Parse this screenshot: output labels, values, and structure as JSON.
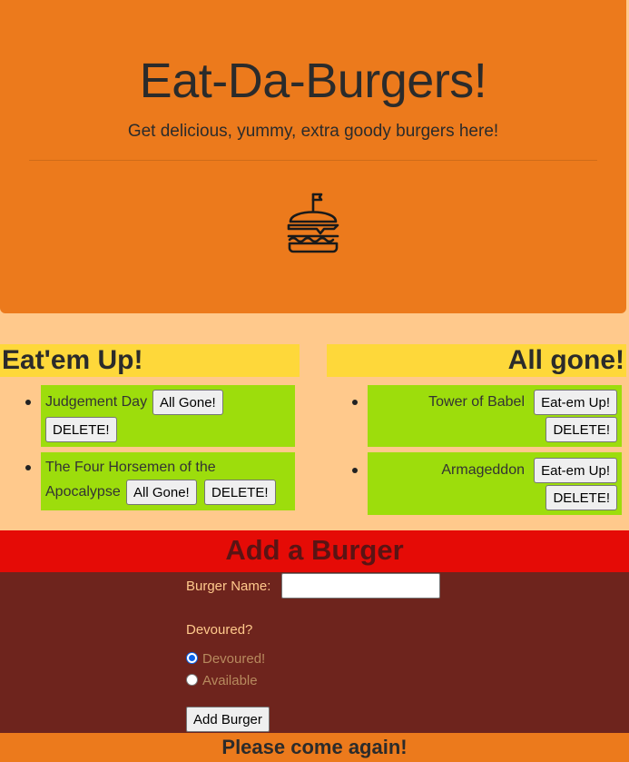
{
  "header": {
    "title": "Eat-Da-Burgers!",
    "lead": "Get delicious, yummy, extra goody burgers here!",
    "logo_icon": "burger-icon"
  },
  "uneaten": {
    "heading": "Eat'em Up!",
    "items": [
      {
        "name": "Judgement Day",
        "action": "All Gone!",
        "delete": "DELETE!"
      },
      {
        "name_line1": "The Four Horsemen of the",
        "name_line2": "Apocalypse",
        "action": "All Gone!",
        "delete": "DELETE!"
      }
    ]
  },
  "eaten": {
    "heading": "All gone!",
    "items": [
      {
        "name": "Tower of Babel",
        "action": "Eat-em Up!",
        "delete": "DELETE!"
      },
      {
        "name": "Armageddon",
        "action": "Eat-em Up!",
        "delete": "DELETE!"
      }
    ]
  },
  "form": {
    "heading": "Add a Burger",
    "name_label": "Burger Name:",
    "name_value": "",
    "devoured_label": "Devoured?",
    "options": [
      "Devoured!",
      "Available"
    ],
    "selected": "Devoured!",
    "submit": "Add Burger"
  },
  "footer": {
    "text": "Please come again!"
  },
  "colors": {
    "jumbotron": "#ec7a1c",
    "page_bg": "#ffc98c",
    "column_heading": "#fed83a",
    "item_bg": "#9ddd0c",
    "add_heading": "#e50b06",
    "form_bg": "#6e241d"
  }
}
